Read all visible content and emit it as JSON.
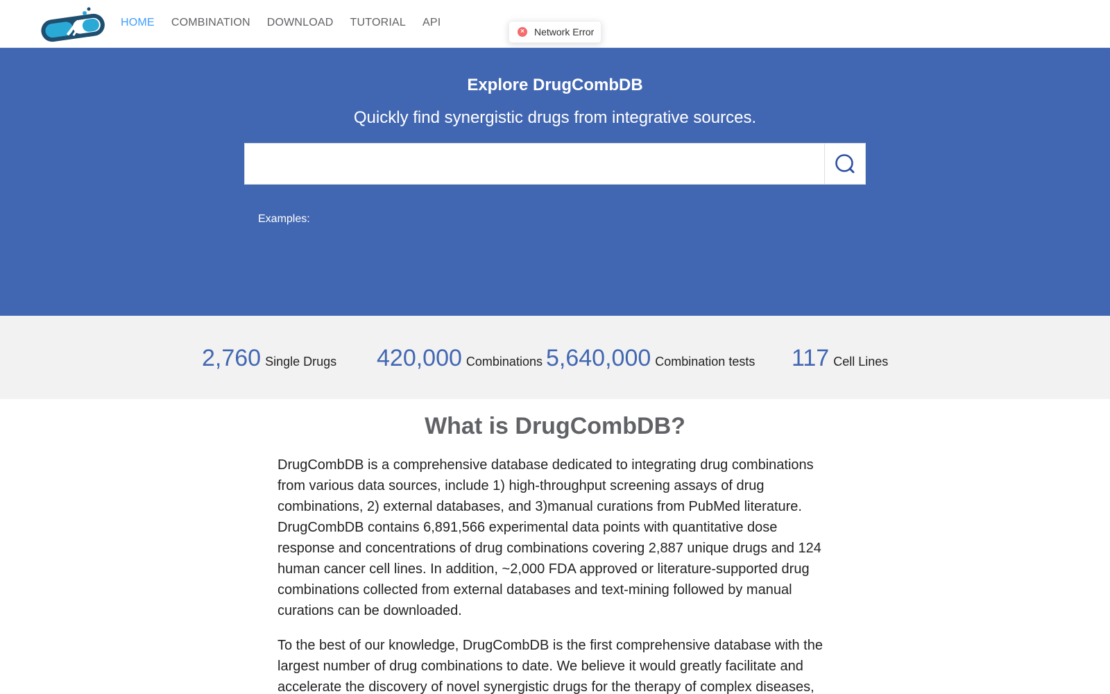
{
  "nav": {
    "items": [
      {
        "label": "HOME",
        "active": true
      },
      {
        "label": "COMBINATION",
        "active": false
      },
      {
        "label": "DOWNLOAD",
        "active": false
      },
      {
        "label": "TUTORIAL",
        "active": false
      },
      {
        "label": "API",
        "active": false
      }
    ]
  },
  "toast": {
    "icon": "error-circle-icon",
    "text": "Network Error",
    "color": "#f56c6c"
  },
  "hero": {
    "title": "Explore DrugCombDB",
    "subtitle": "Quickly find synergistic drugs from integrative sources.",
    "search_value": "",
    "search_icon": "search-icon",
    "examples_label": "Examples:"
  },
  "stats": [
    {
      "number": "2,760",
      "label": "Single Drugs"
    },
    {
      "number": "420,000",
      "label": "Combinations"
    },
    {
      "number": "5,640,000",
      "label": "Combination tests"
    },
    {
      "number": "117",
      "label": "Cell Lines"
    }
  ],
  "about": {
    "title": "What is DrugCombDB?",
    "paragraphs": [
      "DrugCombDB is a comprehensive database dedicated to integrating drug combinations from various data sources, include 1) high-throughput screening assays of drug combinations, 2) external databases, and 3)manual curations from PubMed literature. DrugCombDB contains 6,891,566 experimental data points with quantitative dose response and concentrations of drug combinations covering 2,887 unique drugs and 124 human cancer cell lines. In addition, ~2,000 FDA approved or literature-supported drug combinations collected from external databases and text-mining followed by manual curations can be downloaded.",
      "To the best of our knowledge, DrugCombDB is the first comprehensive database with the largest number of drug combinations to date. We believe it would greatly facilitate and accelerate the discovery of novel synergistic drugs for the therapy of complex diseases,"
    ]
  },
  "colors": {
    "brand": "#4267b2",
    "nav_active": "#409eff",
    "nav_text": "#606266",
    "stats_bg": "#f2f2f2"
  }
}
